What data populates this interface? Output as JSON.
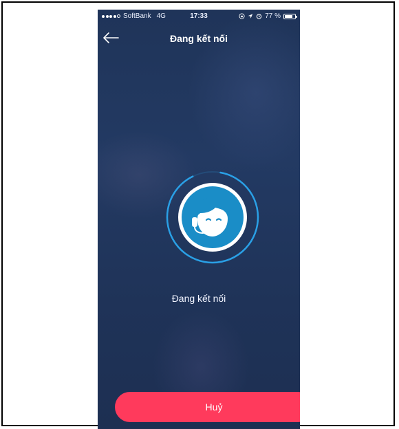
{
  "status_bar": {
    "carrier": "SoftBank",
    "network": "4G",
    "time": "17:33",
    "battery_text": "77 %",
    "battery_level": 0.77,
    "icons": [
      "lock-rotation-icon",
      "location-icon",
      "alarm-icon",
      "battery-icon"
    ]
  },
  "header": {
    "title": "Đang kết nối",
    "back_icon": "arrow-left-icon"
  },
  "main": {
    "avatar_icon": "support-agent-icon",
    "status_text": "Đang kết nối",
    "progress_ring_fraction": 0.9
  },
  "footer": {
    "cancel_label": "Huỷ"
  },
  "colors": {
    "accent_red": "#ff3a5c",
    "progress_blue": "#2aa0e6",
    "avatar_bg": "#1a8dc7",
    "background": "#213660"
  }
}
